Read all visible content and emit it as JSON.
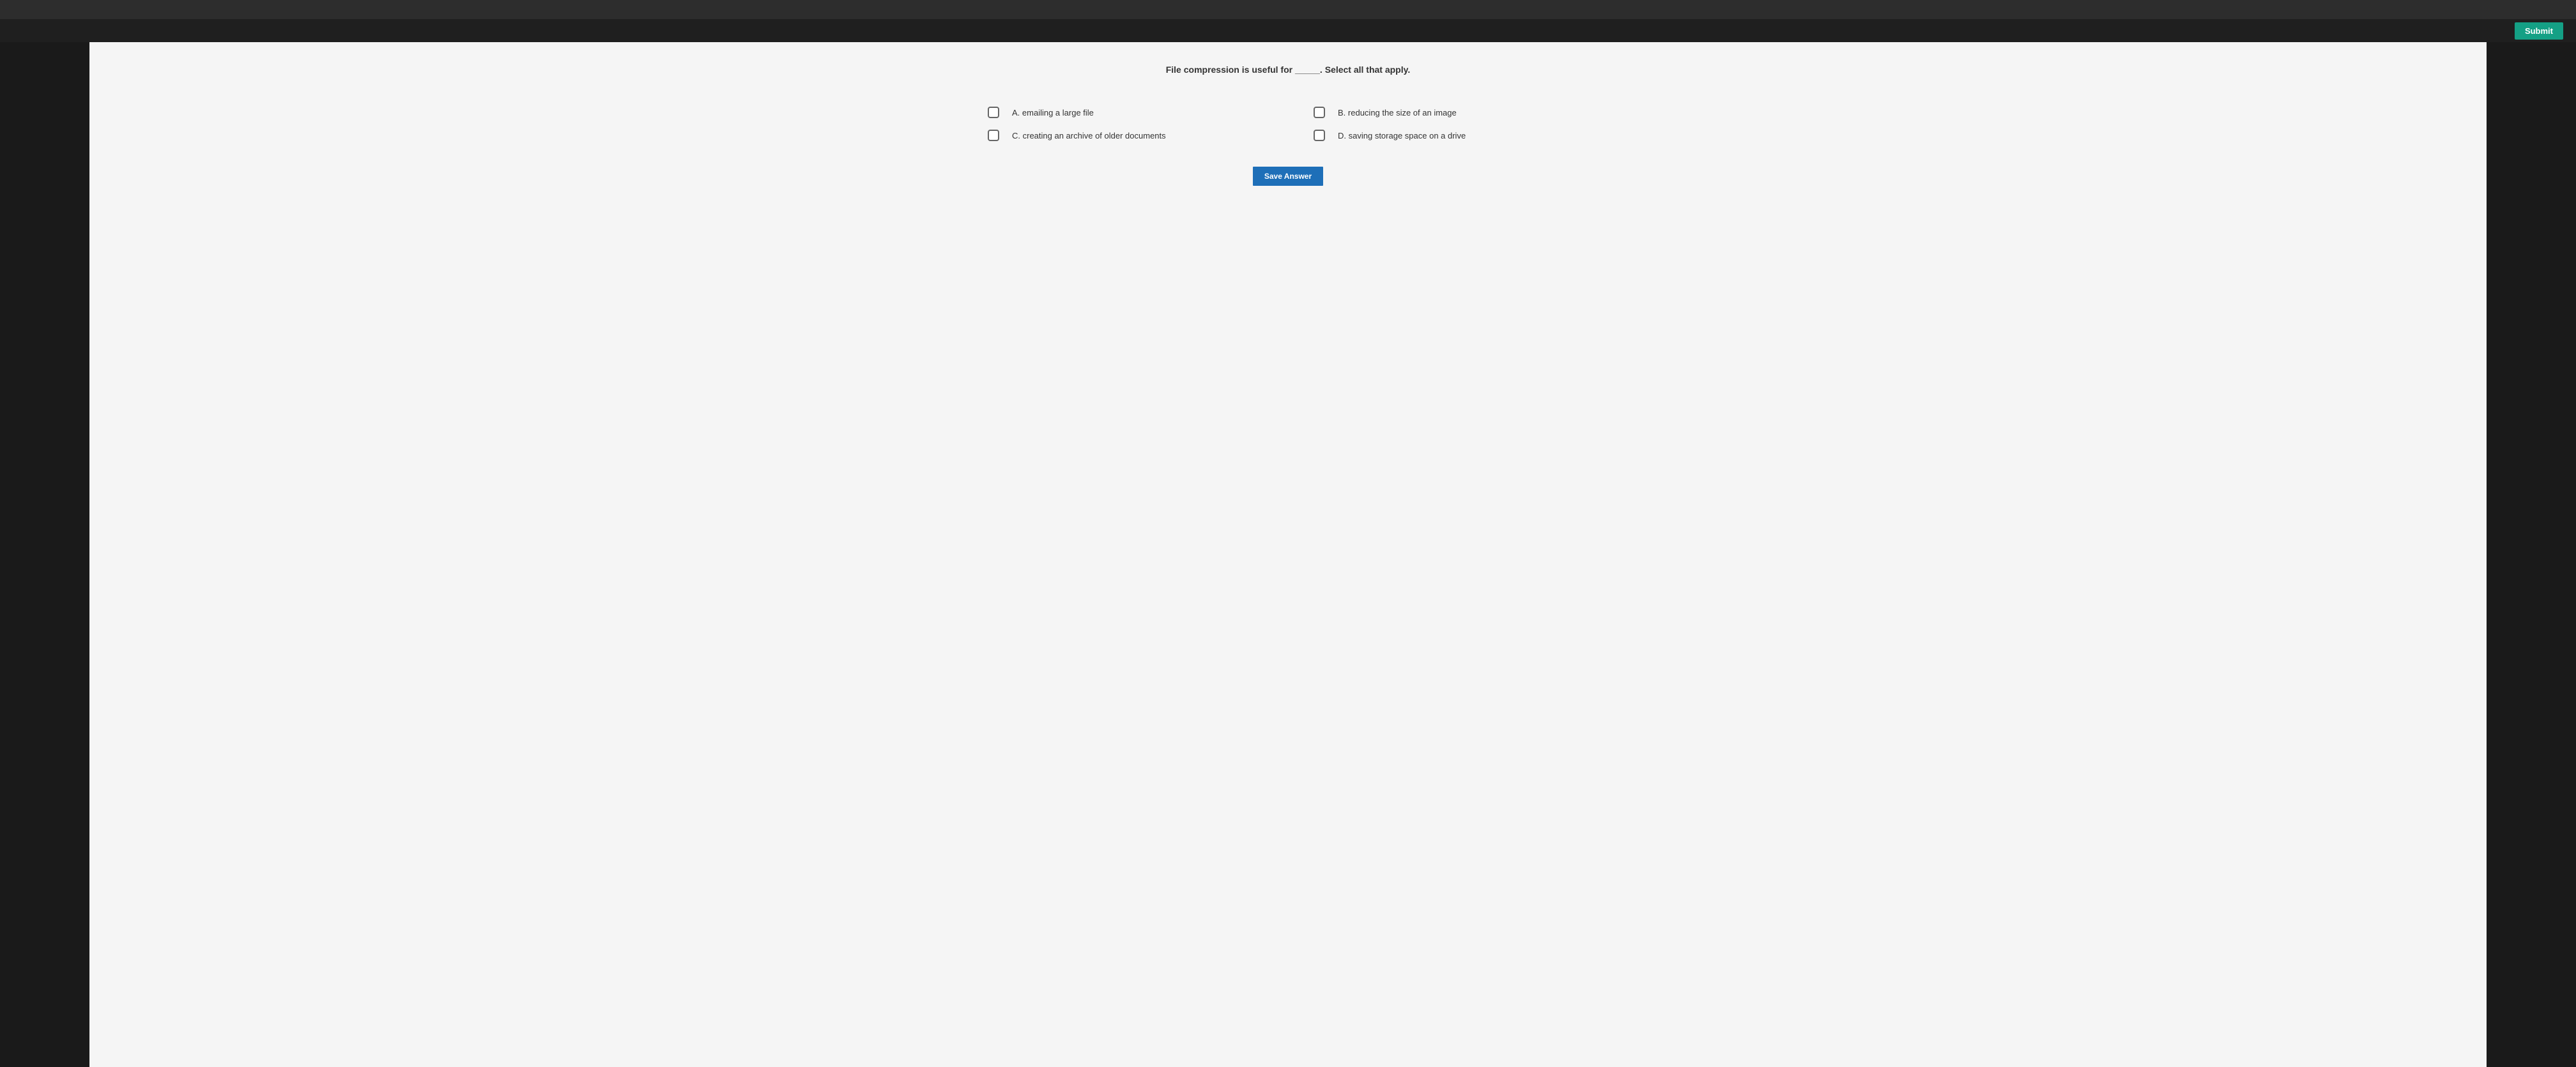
{
  "header": {
    "submit_label": "Submit"
  },
  "question": {
    "text": "File compression is useful for _____. Select all that apply."
  },
  "options": [
    {
      "letter": "A",
      "text": "emailing a large file"
    },
    {
      "letter": "B",
      "text": "reducing the size of an image"
    },
    {
      "letter": "C",
      "text": "creating an archive of older documents"
    },
    {
      "letter": "D",
      "text": "saving storage space on a drive"
    }
  ],
  "actions": {
    "save_answer_label": "Save Answer"
  }
}
